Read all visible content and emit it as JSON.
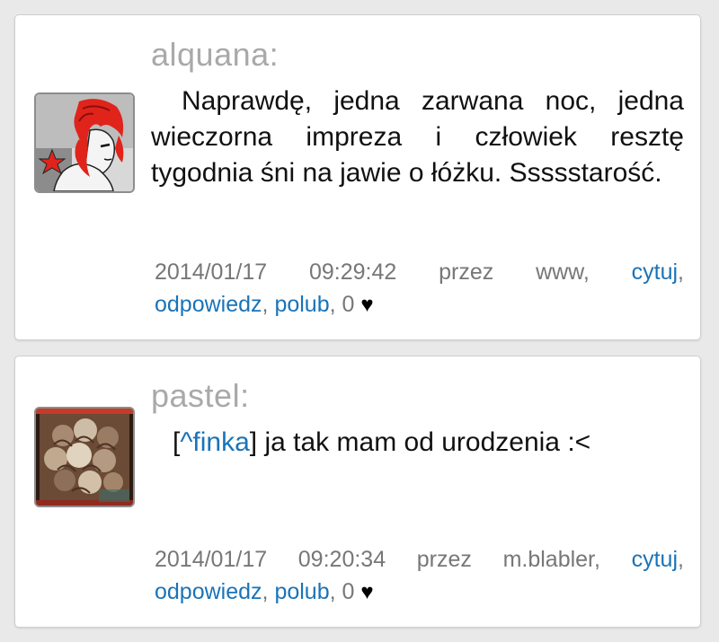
{
  "comments": [
    {
      "author": "alquana:",
      "text": "Naprawdę, jedna zarwana noc, jedna wieczorna impreza i człowiek resztę tygodnia śni na jawie o łóżku. Ssssstarość.",
      "date": "2014/01/17",
      "time": "09:29:42",
      "via_prefix": "przez",
      "via_source": "www,",
      "actions": {
        "quote": "cytuj",
        "reply": "odpowiedz",
        "like": "polub"
      },
      "like_count": "0",
      "avatar": "red-haired-woman-illustration"
    },
    {
      "author": "pastel:",
      "quote_open": "[",
      "quote_user": "^finka",
      "quote_close": "]",
      "text": " ja tak mam od urodzenia :<",
      "date": "2014/01/17",
      "time": "09:20:34",
      "via_prefix": "przez",
      "via_source": "m.blabler,",
      "actions": {
        "quote": "cytuj",
        "reply": "odpowiedz",
        "like": "polub"
      },
      "like_count": "0",
      "avatar": "curly-hair-photo"
    }
  ],
  "ui": {
    "comma": ",",
    "heart_icon": "heart-icon",
    "colors": {
      "link": "#1a73b8",
      "author": "#a9a9a9",
      "meta": "#777777",
      "background": "#e9e9e9"
    }
  }
}
